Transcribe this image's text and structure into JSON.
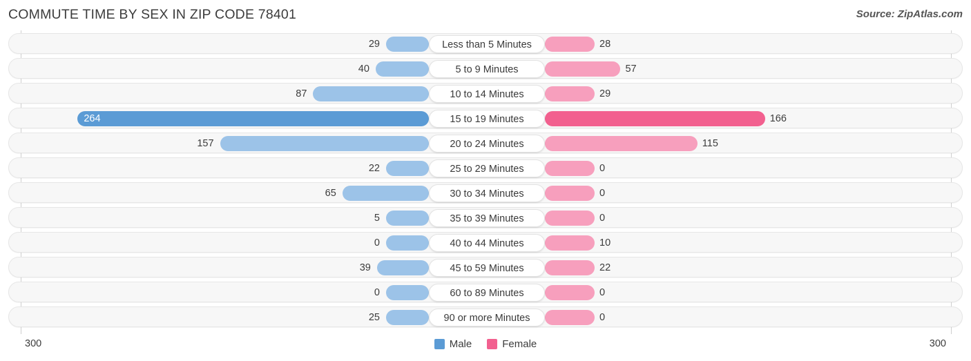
{
  "header": {
    "title": "COMMUTE TIME BY SEX IN ZIP CODE 78401",
    "source": "Source: ZipAtlas.com"
  },
  "axis": {
    "left_max_label": "300",
    "right_max_label": "300"
  },
  "legend": {
    "items": [
      {
        "label": "Male",
        "color": "#5b9bd5"
      },
      {
        "label": "Female",
        "color": "#f2608f"
      }
    ]
  },
  "colors": {
    "male_strong": "#5b9bd5",
    "male_light": "#9cc3e8",
    "female_strong": "#f2608f",
    "female_light": "#f79fbd",
    "row_background": "#f7f7f7",
    "row_border": "#e6e6e6",
    "axis_line": "#cfcfcf"
  },
  "chart_data": {
    "type": "bar",
    "orientation": "horizontal",
    "style": "diverging-butterfly",
    "title": "COMMUTE TIME BY SEX IN ZIP CODE 78401",
    "xlabel": "",
    "ylabel": "",
    "xlim": [
      300,
      300
    ],
    "grid": false,
    "legend_position": "bottom-center",
    "categories": [
      "Less than 5 Minutes",
      "5 to 9 Minutes",
      "10 to 14 Minutes",
      "15 to 19 Minutes",
      "20 to 24 Minutes",
      "25 to 29 Minutes",
      "30 to 34 Minutes",
      "35 to 39 Minutes",
      "40 to 44 Minutes",
      "45 to 59 Minutes",
      "60 to 89 Minutes",
      "90 or more Minutes"
    ],
    "series": [
      {
        "name": "Male",
        "values": [
          29,
          40,
          87,
          264,
          157,
          22,
          65,
          5,
          0,
          39,
          0,
          25
        ]
      },
      {
        "name": "Female",
        "values": [
          28,
          57,
          29,
          166,
          115,
          0,
          0,
          0,
          10,
          22,
          0,
          0
        ]
      }
    ]
  },
  "rows": [
    {
      "category": "Less than 5 Minutes",
      "male": 29,
      "female": 28,
      "male_label": "29",
      "female_label": "28"
    },
    {
      "category": "5 to 9 Minutes",
      "male": 40,
      "female": 57,
      "male_label": "40",
      "female_label": "57"
    },
    {
      "category": "10 to 14 Minutes",
      "male": 87,
      "female": 29,
      "male_label": "87",
      "female_label": "29"
    },
    {
      "category": "15 to 19 Minutes",
      "male": 264,
      "female": 166,
      "male_label": "264",
      "female_label": "166"
    },
    {
      "category": "20 to 24 Minutes",
      "male": 157,
      "female": 115,
      "male_label": "157",
      "female_label": "115"
    },
    {
      "category": "25 to 29 Minutes",
      "male": 22,
      "female": 0,
      "male_label": "22",
      "female_label": "0"
    },
    {
      "category": "30 to 34 Minutes",
      "male": 65,
      "female": 0,
      "male_label": "65",
      "female_label": "0"
    },
    {
      "category": "35 to 39 Minutes",
      "male": 5,
      "female": 0,
      "male_label": "5",
      "female_label": "0"
    },
    {
      "category": "40 to 44 Minutes",
      "male": 0,
      "female": 10,
      "male_label": "0",
      "female_label": "10"
    },
    {
      "category": "45 to 59 Minutes",
      "male": 39,
      "female": 22,
      "male_label": "39",
      "female_label": "22"
    },
    {
      "category": "60 to 89 Minutes",
      "male": 0,
      "female": 0,
      "male_label": "0",
      "female_label": "0"
    },
    {
      "category": "90 or more Minutes",
      "male": 25,
      "female": 0,
      "male_label": "25",
      "female_label": "0"
    }
  ]
}
